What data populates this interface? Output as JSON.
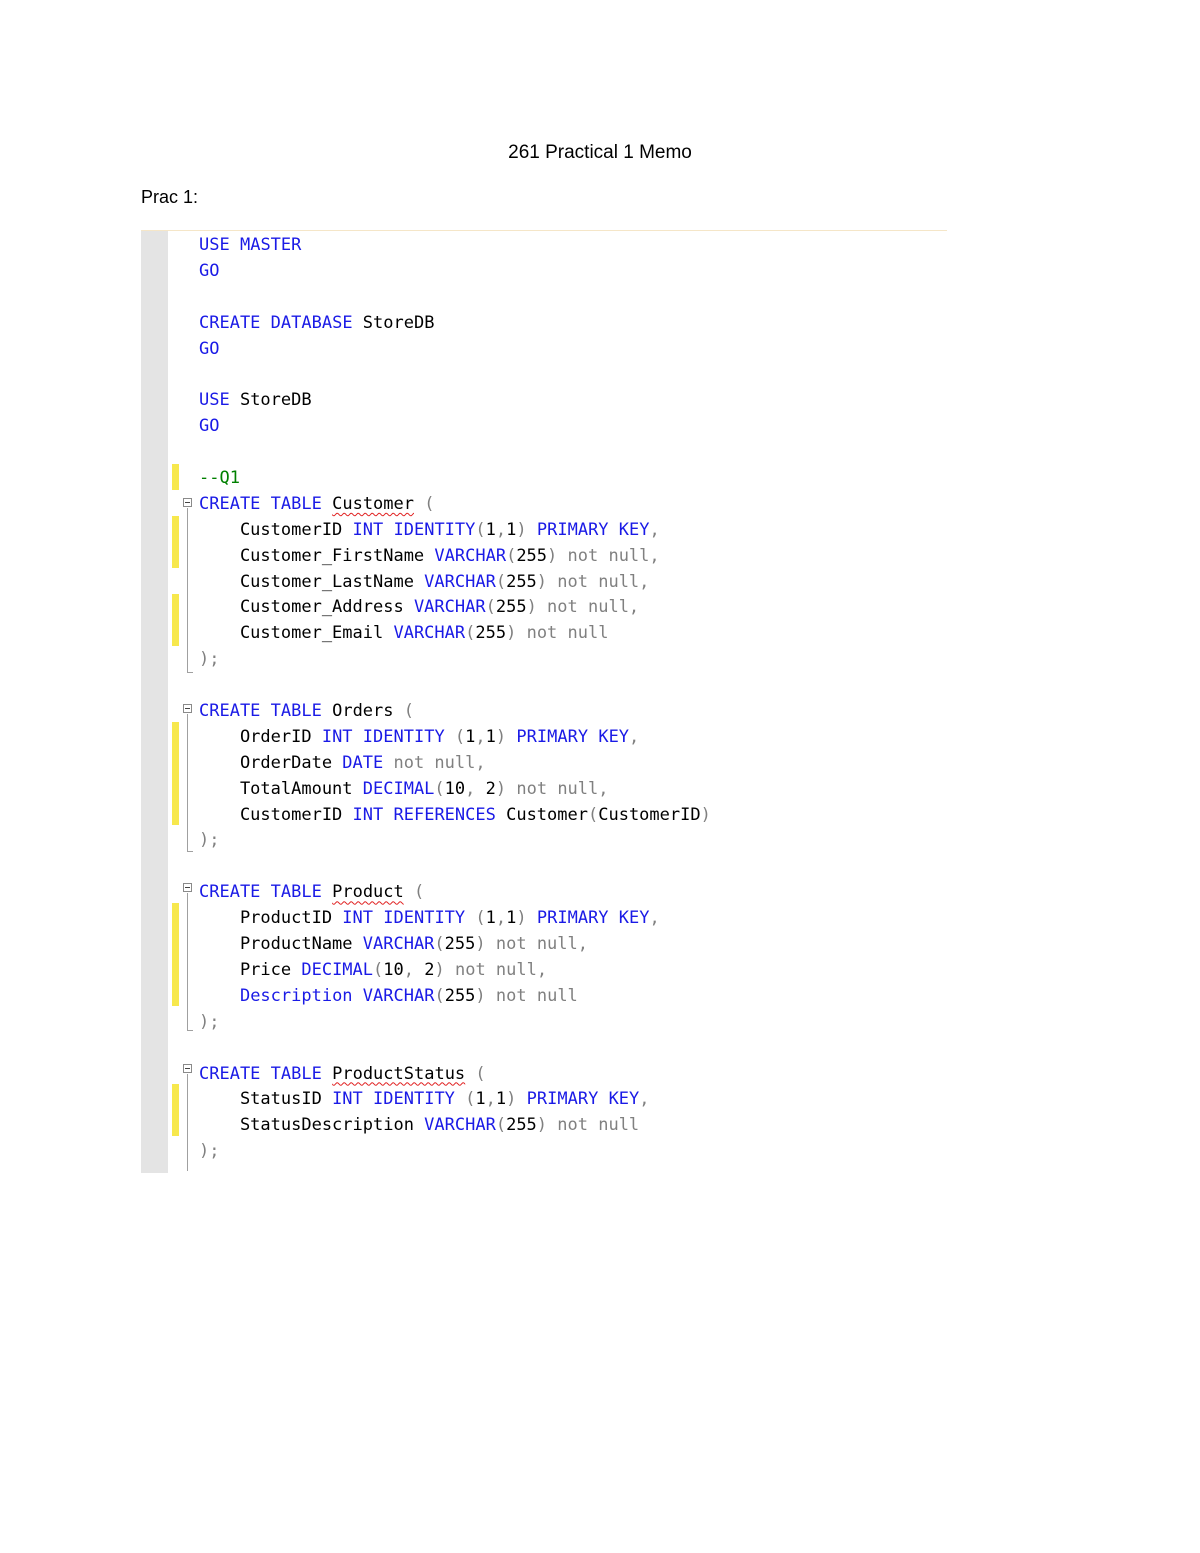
{
  "document": {
    "title": "261 Practical 1 Memo",
    "section": "Prac 1:"
  },
  "editor": {
    "colors": {
      "keyword": "#1a1ae6",
      "punctuation": "#808080",
      "comment": "#008000",
      "identifier": "#000000",
      "gutter": "#e4e4e4",
      "change_marker": "#f7e84d",
      "squiggle": "#e02020"
    },
    "lines": [
      [
        {
          "t": "USE",
          "c": "kw"
        },
        {
          "t": " "
        },
        {
          "t": "MASTER",
          "c": "kw"
        }
      ],
      [
        {
          "t": "GO",
          "c": "kw"
        }
      ],
      [],
      [
        {
          "t": "CREATE",
          "c": "kw"
        },
        {
          "t": " "
        },
        {
          "t": "DATABASE",
          "c": "kw"
        },
        {
          "t": " StoreDB"
        }
      ],
      [
        {
          "t": "GO",
          "c": "kw"
        }
      ],
      [],
      [
        {
          "t": "USE",
          "c": "kw"
        },
        {
          "t": " StoreDB"
        }
      ],
      [
        {
          "t": "GO",
          "c": "kw"
        }
      ],
      [],
      [
        {
          "t": "--Q1",
          "c": "cm"
        }
      ],
      [
        {
          "t": "CREATE",
          "c": "kw"
        },
        {
          "t": " "
        },
        {
          "t": "TABLE",
          "c": "kw"
        },
        {
          "t": " "
        },
        {
          "t": "Customer",
          "c": "sq"
        },
        {
          "t": " "
        },
        {
          "t": "(",
          "c": "gr"
        }
      ],
      [
        {
          "t": "    CustomerID "
        },
        {
          "t": "INT",
          "c": "kw"
        },
        {
          "t": " "
        },
        {
          "t": "IDENTITY",
          "c": "kw"
        },
        {
          "t": "(",
          "c": "gr"
        },
        {
          "t": "1"
        },
        {
          "t": ",",
          "c": "gr"
        },
        {
          "t": "1"
        },
        {
          "t": ")",
          "c": "gr"
        },
        {
          "t": " "
        },
        {
          "t": "PRIMARY",
          "c": "kw"
        },
        {
          "t": " "
        },
        {
          "t": "KEY",
          "c": "kw"
        },
        {
          "t": ",",
          "c": "gr"
        }
      ],
      [
        {
          "t": "    Customer_FirstName "
        },
        {
          "t": "VARCHAR",
          "c": "kw"
        },
        {
          "t": "(",
          "c": "gr"
        },
        {
          "t": "255"
        },
        {
          "t": ")",
          "c": "gr"
        },
        {
          "t": " not null,",
          "c": "gr"
        }
      ],
      [
        {
          "t": "    Customer_LastName "
        },
        {
          "t": "VARCHAR",
          "c": "kw"
        },
        {
          "t": "(",
          "c": "gr"
        },
        {
          "t": "255"
        },
        {
          "t": ")",
          "c": "gr"
        },
        {
          "t": " not null,",
          "c": "gr"
        }
      ],
      [
        {
          "t": "    Customer_Address "
        },
        {
          "t": "VARCHAR",
          "c": "kw"
        },
        {
          "t": "(",
          "c": "gr"
        },
        {
          "t": "255"
        },
        {
          "t": ")",
          "c": "gr"
        },
        {
          "t": " not null,",
          "c": "gr"
        }
      ],
      [
        {
          "t": "    Customer_Email "
        },
        {
          "t": "VARCHAR",
          "c": "kw"
        },
        {
          "t": "(",
          "c": "gr"
        },
        {
          "t": "255"
        },
        {
          "t": ")",
          "c": "gr"
        },
        {
          "t": " not null",
          "c": "gr"
        }
      ],
      [
        {
          "t": ");",
          "c": "gr"
        }
      ],
      [],
      [
        {
          "t": "CREATE",
          "c": "kw"
        },
        {
          "t": " "
        },
        {
          "t": "TABLE",
          "c": "kw"
        },
        {
          "t": " Orders "
        },
        {
          "t": "(",
          "c": "gr"
        }
      ],
      [
        {
          "t": "    OrderID "
        },
        {
          "t": "INT",
          "c": "kw"
        },
        {
          "t": " "
        },
        {
          "t": "IDENTITY",
          "c": "kw"
        },
        {
          "t": " (",
          "c": "gr"
        },
        {
          "t": "1"
        },
        {
          "t": ",",
          "c": "gr"
        },
        {
          "t": "1"
        },
        {
          "t": ")",
          "c": "gr"
        },
        {
          "t": " "
        },
        {
          "t": "PRIMARY",
          "c": "kw"
        },
        {
          "t": " "
        },
        {
          "t": "KEY",
          "c": "kw"
        },
        {
          "t": ",",
          "c": "gr"
        }
      ],
      [
        {
          "t": "    OrderDate "
        },
        {
          "t": "DATE",
          "c": "kw"
        },
        {
          "t": " not null,",
          "c": "gr"
        }
      ],
      [
        {
          "t": "    TotalAmount "
        },
        {
          "t": "DECIMAL",
          "c": "kw"
        },
        {
          "t": "(",
          "c": "gr"
        },
        {
          "t": "10"
        },
        {
          "t": ", ",
          "c": "gr"
        },
        {
          "t": "2"
        },
        {
          "t": ")",
          "c": "gr"
        },
        {
          "t": " not null,",
          "c": "gr"
        }
      ],
      [
        {
          "t": "    CustomerID "
        },
        {
          "t": "INT",
          "c": "kw"
        },
        {
          "t": " "
        },
        {
          "t": "REFERENCES",
          "c": "kw"
        },
        {
          "t": " Customer"
        },
        {
          "t": "(",
          "c": "gr"
        },
        {
          "t": "CustomerID"
        },
        {
          "t": ")",
          "c": "gr"
        }
      ],
      [
        {
          "t": ");",
          "c": "gr"
        }
      ],
      [],
      [
        {
          "t": "CREATE",
          "c": "kw"
        },
        {
          "t": " "
        },
        {
          "t": "TABLE",
          "c": "kw"
        },
        {
          "t": " "
        },
        {
          "t": "Product",
          "c": "sq"
        },
        {
          "t": " "
        },
        {
          "t": "(",
          "c": "gr"
        }
      ],
      [
        {
          "t": "    ProductID "
        },
        {
          "t": "INT",
          "c": "kw"
        },
        {
          "t": " "
        },
        {
          "t": "IDENTITY",
          "c": "kw"
        },
        {
          "t": " (",
          "c": "gr"
        },
        {
          "t": "1"
        },
        {
          "t": ",",
          "c": "gr"
        },
        {
          "t": "1"
        },
        {
          "t": ")",
          "c": "gr"
        },
        {
          "t": " "
        },
        {
          "t": "PRIMARY",
          "c": "kw"
        },
        {
          "t": " "
        },
        {
          "t": "KEY",
          "c": "kw"
        },
        {
          "t": ",",
          "c": "gr"
        }
      ],
      [
        {
          "t": "    ProductName "
        },
        {
          "t": "VARCHAR",
          "c": "kw"
        },
        {
          "t": "(",
          "c": "gr"
        },
        {
          "t": "255"
        },
        {
          "t": ")",
          "c": "gr"
        },
        {
          "t": " not null,",
          "c": "gr"
        }
      ],
      [
        {
          "t": "    Price "
        },
        {
          "t": "DECIMAL",
          "c": "kw"
        },
        {
          "t": "(",
          "c": "gr"
        },
        {
          "t": "10"
        },
        {
          "t": ", ",
          "c": "gr"
        },
        {
          "t": "2"
        },
        {
          "t": ")",
          "c": "gr"
        },
        {
          "t": " not null,",
          "c": "gr"
        }
      ],
      [
        {
          "t": "    "
        },
        {
          "t": "Description",
          "c": "kw"
        },
        {
          "t": " "
        },
        {
          "t": "VARCHAR",
          "c": "kw"
        },
        {
          "t": "(",
          "c": "gr"
        },
        {
          "t": "255"
        },
        {
          "t": ")",
          "c": "gr"
        },
        {
          "t": " not null",
          "c": "gr"
        }
      ],
      [
        {
          "t": ");",
          "c": "gr"
        }
      ],
      [],
      [
        {
          "t": "CREATE",
          "c": "kw"
        },
        {
          "t": " "
        },
        {
          "t": "TABLE",
          "c": "kw"
        },
        {
          "t": " "
        },
        {
          "t": "ProductStatus",
          "c": "sq"
        },
        {
          "t": " "
        },
        {
          "t": "(",
          "c": "gr"
        }
      ],
      [
        {
          "t": "    StatusID "
        },
        {
          "t": "INT",
          "c": "kw"
        },
        {
          "t": " "
        },
        {
          "t": "IDENTITY",
          "c": "kw"
        },
        {
          "t": " (",
          "c": "gr"
        },
        {
          "t": "1"
        },
        {
          "t": ",",
          "c": "gr"
        },
        {
          "t": "1"
        },
        {
          "t": ")",
          "c": "gr"
        },
        {
          "t": " "
        },
        {
          "t": "PRIMARY",
          "c": "kw"
        },
        {
          "t": " "
        },
        {
          "t": "KEY",
          "c": "kw"
        },
        {
          "t": ",",
          "c": "gr"
        }
      ],
      [
        {
          "t": "    StatusDescription "
        },
        {
          "t": "VARCHAR",
          "c": "kw"
        },
        {
          "t": "(",
          "c": "gr"
        },
        {
          "t": "255"
        },
        {
          "t": ")",
          "c": "gr"
        },
        {
          "t": " not null",
          "c": "gr"
        }
      ],
      [
        {
          "t": ");",
          "c": "gr"
        }
      ]
    ]
  }
}
